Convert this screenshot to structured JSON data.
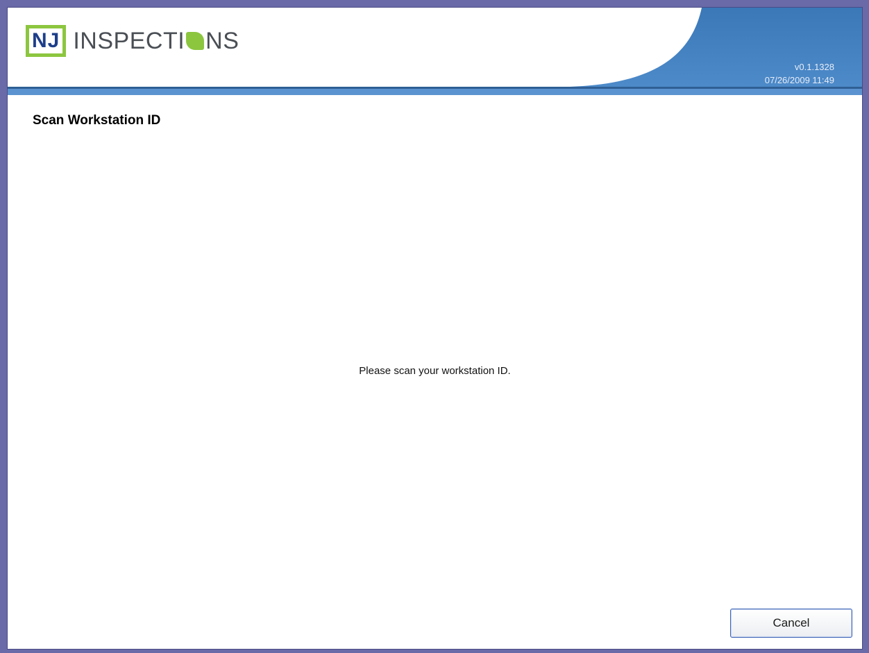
{
  "header": {
    "logo_nj": "NJ",
    "logo_word_pre": "INSPECTI",
    "logo_word_post": "NS",
    "version": "v0.1.1328",
    "datetime": "07/26/2009 11:49"
  },
  "page": {
    "title": "Scan Workstation ID",
    "instruction": "Please scan your workstation ID."
  },
  "actions": {
    "cancel_label": "Cancel"
  },
  "colors": {
    "header_blue": "#3f7fbd",
    "logo_green": "#8cc63f",
    "window_frame": "#6a6aa8"
  }
}
